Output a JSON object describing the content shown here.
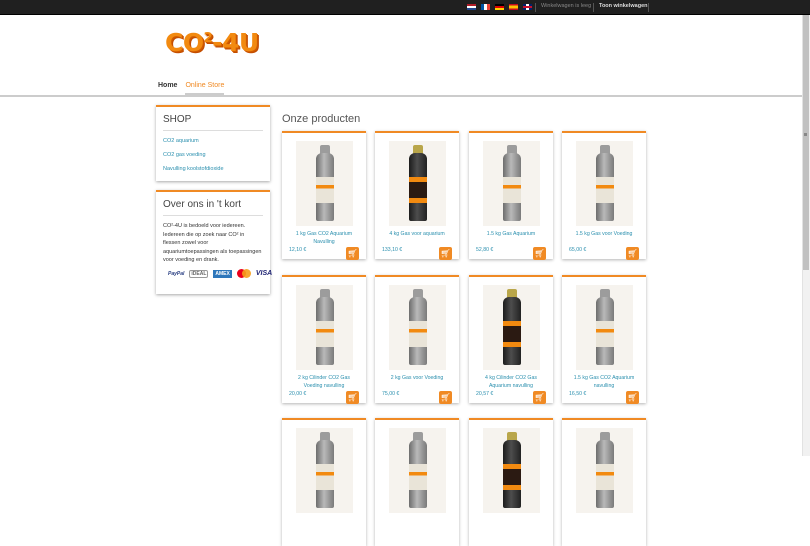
{
  "topbar": {
    "flags": [
      "nl",
      "fr",
      "de",
      "es",
      "gb"
    ],
    "cart_status": "Winkelwagen is leeg",
    "show_cart": "Toon winkelwagen"
  },
  "logo": {
    "text": "CO",
    "sup": "2",
    "suffix": "-4U"
  },
  "nav": {
    "home": "Home",
    "store": "Online Store"
  },
  "shop": {
    "title": "SHOP",
    "links": [
      "CO2 aquarium",
      "CO2 gas voeding",
      "Navulling koolstofdioxide"
    ]
  },
  "about": {
    "title": "Over ons in 't kort",
    "text": "CO²-4U is bedoeld voor iedereen. Iedereen die op zoek naar CO² in flessen zowel voor aquariumtoepassingen als toepassingen voor voeding en drank.",
    "payments": [
      "PayPal",
      "iDEAL",
      "AMEX",
      "mastercard",
      "VISA"
    ]
  },
  "products_heading": "Onze producten",
  "products": [
    {
      "title": "1 kg Gas CO2 Aquarium Navulling",
      "price": "12,10 €",
      "style": "grey"
    },
    {
      "title": "4 kg Gas voor aquarium",
      "price": "133,10 €",
      "style": "dark"
    },
    {
      "title": "1.5 kg Gas Aquarium",
      "price": "52,80 €",
      "style": "grey"
    },
    {
      "title": "1.5 kg Gas voor Voeding",
      "price": "65,00 €",
      "style": "grey"
    },
    {
      "title": "2 kg Cilinder CO2 Gas Voeding navulling",
      "price": "20,00 €",
      "style": "grey"
    },
    {
      "title": "2 kg Gas voor Voeding",
      "price": "75,00 €",
      "style": "grey"
    },
    {
      "title": "4 kg Cilinder CO2 Gas Aquarium navulling",
      "price": "20,57 €",
      "style": "dark"
    },
    {
      "title": "1.5 kg Gas CO2 Aquarium navulling",
      "price": "16,50 €",
      "style": "grey"
    },
    {
      "title": "",
      "price": "",
      "style": "grey"
    },
    {
      "title": "",
      "price": "",
      "style": "grey"
    },
    {
      "title": "",
      "price": "",
      "style": "dark"
    },
    {
      "title": "",
      "price": "",
      "style": "grey"
    }
  ],
  "icons": {
    "cart": "shopping-basket-icon"
  },
  "colors": {
    "accent": "#f08a24",
    "link": "#2a8fae",
    "topbar": "#202020"
  }
}
